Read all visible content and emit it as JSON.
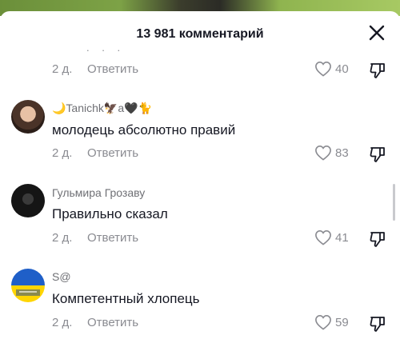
{
  "header": {
    "title": "13 981 комментарий",
    "ellipsis": ". . ."
  },
  "comments": [
    {
      "username": "",
      "text": "",
      "date": "2 д.",
      "reply": "Ответить",
      "likes": "40"
    },
    {
      "username": "🌙Tanichk🦅a🖤🐈",
      "text": "молодець абсолютно правий",
      "date": "2 д.",
      "reply": "Ответить",
      "likes": "83"
    },
    {
      "username": "Гульмира Грозаву",
      "text": "Правильно сказал",
      "date": "2 д.",
      "reply": "Ответить",
      "likes": "41"
    },
    {
      "username": "S@",
      "text": "Компетентный хлопець",
      "date": "2 д.",
      "reply": "Ответить",
      "likes": "59"
    }
  ],
  "icons": {
    "close": "close-icon",
    "like": "heart-outline-icon",
    "dislike": "thumb-down-icon"
  },
  "colors": {
    "text": "#161823",
    "muted": "#8a8b91",
    "flag_blue": "#1f5fc8",
    "flag_yellow": "#ffd500"
  }
}
